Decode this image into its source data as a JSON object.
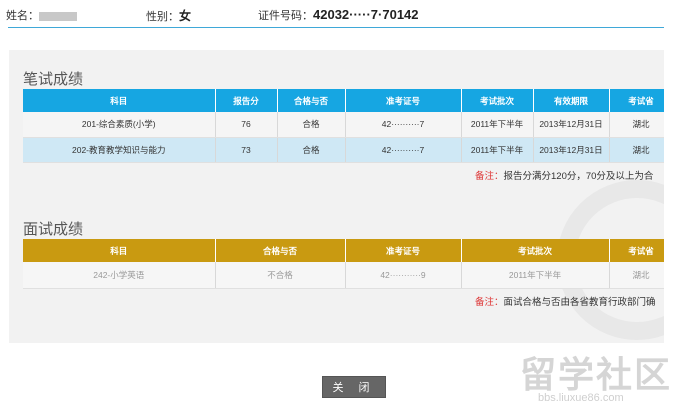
{
  "header": {
    "name_label": "姓名：",
    "name_value": "",
    "gender_label": "性别：",
    "gender_value": "女",
    "id_label": "证件号码：",
    "id_value": "42032·····7·70142"
  },
  "written": {
    "title": "笔试成绩",
    "columns": [
      "科目",
      "报告分",
      "合格与否",
      "准考证号",
      "考试批次",
      "有效期限",
      "考试省"
    ],
    "rows": [
      [
        "201-综合素质(小学)",
        "76",
        "合格",
        "42··········7",
        "2011年下半年",
        "2013年12月31日",
        "湖北"
      ],
      [
        "202-教育教学知识与能力",
        "73",
        "合格",
        "42··········7",
        "2011年下半年",
        "2013年12月31日",
        "湖北"
      ]
    ],
    "note_label": "备注：",
    "note_text": "报告分满分120分，70分及以上为合"
  },
  "interview": {
    "title": "面试成绩",
    "columns": [
      "科目",
      "合格与否",
      "准考证号",
      "考试批次",
      "考试省"
    ],
    "rows": [
      [
        "242-小学英语",
        "不合格",
        "42···········9",
        "2011年下半年",
        "湖北"
      ]
    ],
    "note_label": "备注：",
    "note_text": "面试合格与否由各省教育行政部门确"
  },
  "close_button": "关 闭",
  "watermark": {
    "brand": "留学社区",
    "url": "bbs.liuxue86.com"
  },
  "colors": {
    "written_header": "#16a6e2",
    "interview_header": "#c99a11",
    "note_label": "#dd3333",
    "rule": "#3fa8d8"
  }
}
